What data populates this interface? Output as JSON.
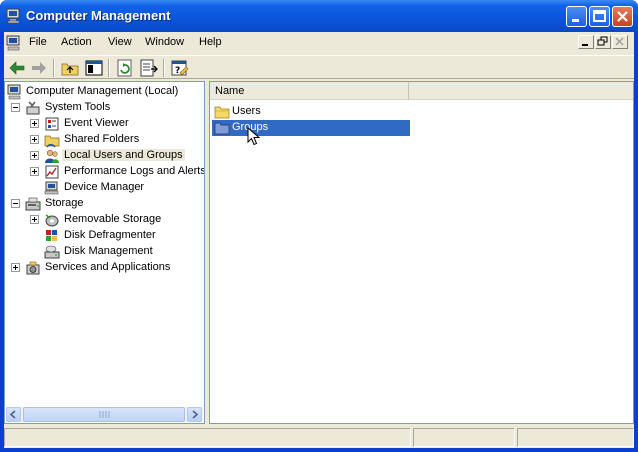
{
  "window": {
    "title": "Computer Management",
    "accent": "#0a3fd0"
  },
  "menu": {
    "items": [
      "File",
      "Action",
      "View",
      "Window",
      "Help"
    ]
  },
  "toolbar": {
    "buttons": [
      "back-arrow-icon",
      "forward-arrow-icon",
      "up-folder-icon",
      "show-hide-tree-icon",
      "refresh-icon",
      "export-list-icon",
      "help-icon"
    ]
  },
  "tree": {
    "root": "Computer Management (Local)",
    "items": [
      {
        "label": "System Tools",
        "level": 1,
        "expander": "minus",
        "icon": "tools-icon"
      },
      {
        "label": "Event Viewer",
        "level": 2,
        "expander": "plus",
        "icon": "event-viewer-icon"
      },
      {
        "label": "Shared Folders",
        "level": 2,
        "expander": "plus",
        "icon": "shared-folder-icon"
      },
      {
        "label": "Local Users and Groups",
        "level": 2,
        "expander": "plus",
        "icon": "users-icon",
        "selected": true
      },
      {
        "label": "Performance Logs and Alerts",
        "level": 2,
        "expander": "plus",
        "icon": "performance-icon"
      },
      {
        "label": "Device Manager",
        "level": 2,
        "expander": "none",
        "icon": "device-manager-icon"
      },
      {
        "label": "Storage",
        "level": 1,
        "expander": "minus",
        "icon": "storage-icon"
      },
      {
        "label": "Removable Storage",
        "level": 2,
        "expander": "plus",
        "icon": "removable-storage-icon"
      },
      {
        "label": "Disk Defragmenter",
        "level": 2,
        "expander": "none",
        "icon": "defrag-icon"
      },
      {
        "label": "Disk Management",
        "level": 2,
        "expander": "none",
        "icon": "disk-management-icon"
      },
      {
        "label": "Services and Applications",
        "level": 1,
        "expander": "plus",
        "icon": "services-icon"
      }
    ]
  },
  "list": {
    "columns": [
      "Name",
      ""
    ],
    "rows": [
      {
        "label": "Users",
        "selected": false
      },
      {
        "label": "Groups",
        "selected": true
      }
    ]
  }
}
